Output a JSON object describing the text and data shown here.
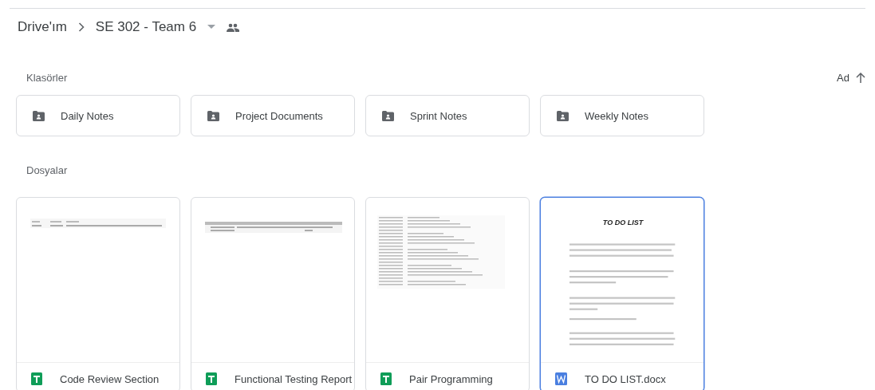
{
  "breadcrumb": [
    {
      "label": "Drive'ım",
      "kind": "root"
    },
    {
      "label": "SE 302 - Team 6",
      "kind": "current",
      "shared": true
    }
  ],
  "sort": {
    "label": "Ad"
  },
  "folders_section": {
    "title": "Klasörler",
    "folders": [
      {
        "name": "Daily Notes",
        "selected": false
      },
      {
        "name": "Project Documents",
        "selected": false
      },
      {
        "name": "Sprint Notes",
        "selected": false
      },
      {
        "name": "Weekly Notes",
        "selected": false
      }
    ]
  },
  "files_section": {
    "title": "Dosyalar",
    "files": [
      {
        "name": "Code Review Section",
        "kind": "sheet",
        "selected": false
      },
      {
        "name": "Functional Testing Report",
        "kind": "sheet",
        "selected": false
      },
      {
        "name": "Pair Programming",
        "kind": "sheet",
        "selected": false
      },
      {
        "name": "TO DO LIST.docx",
        "kind": "word",
        "selected": true,
        "preview_title": "TO DO LIST"
      }
    ]
  }
}
